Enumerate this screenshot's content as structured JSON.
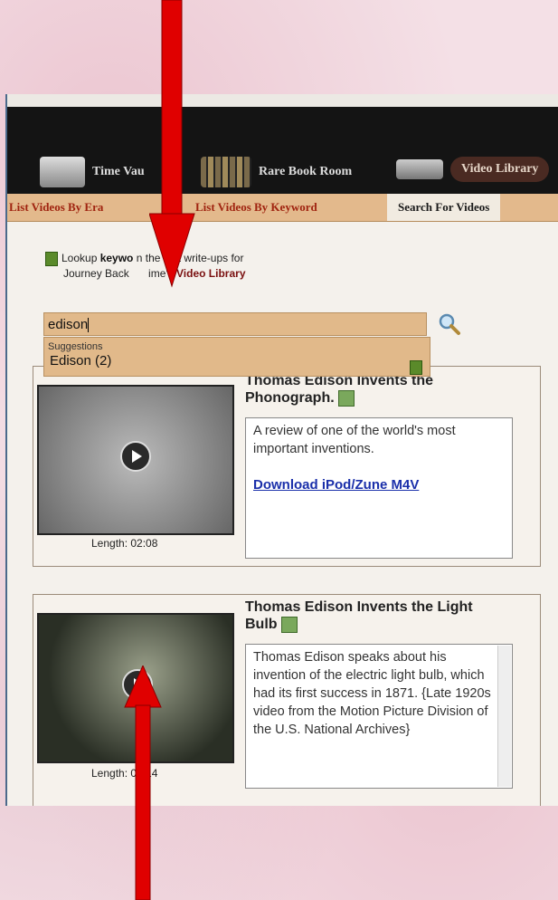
{
  "nav": {
    "items": [
      {
        "label": "Time Vau",
        "icon": "time-vault-icon"
      },
      {
        "label": "Rare Book Room",
        "icon": "books-icon"
      },
      {
        "label": "Video Library",
        "icon": "camera-icon"
      }
    ]
  },
  "tabs": [
    "List Videos By Era",
    "List Videos By Keyword",
    "Search For Videos"
  ],
  "lookup": {
    "line1_pre": "Lookup ",
    "line1_bold": "keywo",
    "line1_post": "n the text write-ups for",
    "line2_pre": "Journey Back ",
    "line2_mid": "ime's ",
    "line2_link": "Video Library"
  },
  "search": {
    "value": "edison",
    "button_icon": "magnifier-icon"
  },
  "suggestions": {
    "header": "Suggestions",
    "items": [
      "Edison (2)"
    ]
  },
  "videos": [
    {
      "title": "Thomas Edison Invents the Phonograph.",
      "title_visible": "Thomas Edison Invents the",
      "title_line2": "Phonograph.",
      "description": "A review of one of the world's most important inventions.",
      "download": "Download iPod/Zune M4V",
      "length": "Length: 02:08"
    },
    {
      "title_line1": "Thomas Edison Invents the Light",
      "title_line2": "Bulb",
      "description": "Thomas Edison speaks about his invention of the electric light bulb, which had its first success in 1871. {Late 1920s video from the Motion Picture Division of the U.S. National Archives}",
      "length": "Length: 02:14"
    }
  ],
  "colors": {
    "arrow": "#e00000",
    "tab_bar": "#e3b98c",
    "tab_text": "#a02410",
    "search_bg": "#e1b98a"
  }
}
